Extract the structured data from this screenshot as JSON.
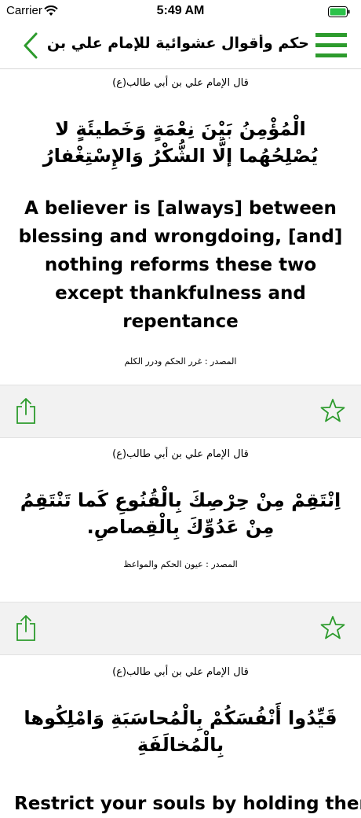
{
  "status_bar": {
    "carrier": "Carrier",
    "time": "5:49 AM"
  },
  "nav": {
    "title": "حكم وأقوال عشوائية للإمام علي بن أبي ط..."
  },
  "colors": {
    "accent": "#2d9b2d"
  },
  "quotes": [
    {
      "attribution": "قال الإمام علي بن أبي طالب(ع)",
      "arabic": "الْمُؤْمِنُ بَيْنَ نِعْمَةٍ وَخَطيئَةٍ لا يُصْلِحُهُما إلَّا الشُّكْرُ وَالإِسْتِغْفارُ",
      "english": "A believer is [always] between blessing and wrongdoing, [and] nothing reforms these two except thankfulness and repentance",
      "source": "المصدر : غرر الحكم ودرر الكلم"
    },
    {
      "attribution": "قال الإمام علي بن أبي طالب(ع)",
      "arabic": "اِنْتَقِمْ مِنْ حِرْصِكَ بِالْقُنُوعِ كَما تَنْتَقِمُ مِنْ عَدُوِّكَ بِالْقِصاصِ.",
      "source": "المصدر : عيون الحكم والمواعظ"
    },
    {
      "attribution": "قال الإمام علي بن أبي طالب(ع)",
      "arabic": "قَيِّدُوا أَنْفُسَكُمْ بِالْمُحاسَبَةِ وَامْلِكُوها بِالْمُخالَفَةِ",
      "english": "Restrict your souls by holding them"
    }
  ]
}
